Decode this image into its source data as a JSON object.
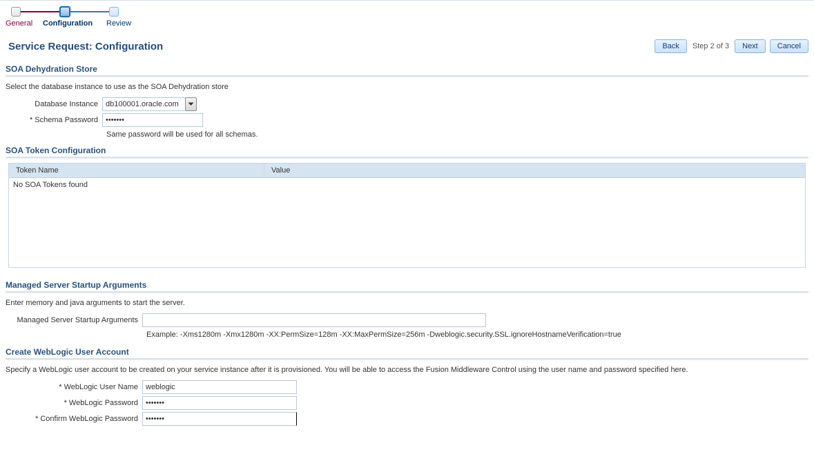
{
  "wizard": {
    "steps": [
      {
        "label": "General"
      },
      {
        "label": "Configuration"
      },
      {
        "label": "Review"
      }
    ],
    "step_indicator": "Step 2 of 3"
  },
  "page_title": "Service Request: Configuration",
  "buttons": {
    "back": "Back",
    "next": "Next",
    "cancel": "Cancel"
  },
  "soa_dehydration": {
    "title": "SOA Dehydration Store",
    "desc": "Select the database instance to use as the SOA Dehydration store",
    "db_label": "Database Instance",
    "db_value": "db100001.oracle.com",
    "schema_pwd_label": "Schema Password",
    "schema_pwd_value": "•••••••",
    "schema_pwd_hint": "Same password will be used for all schemas."
  },
  "soa_token": {
    "title": "SOA Token Configuration",
    "col_name": "Token Name",
    "col_value": "Value",
    "empty_text": "No SOA Tokens found"
  },
  "managed_server": {
    "title": "Managed Server Startup Arguments",
    "desc": "Enter memory and java arguments to start the server.",
    "label": "Managed Server Startup Arguments",
    "value": "",
    "example": "Example: -Xms1280m -Xmx1280m -XX:PermSize=128m -XX:MaxPermSize=256m -Dweblogic.security.SSL.ignoreHostnameVerification=true"
  },
  "weblogic": {
    "title": "Create WebLogic User Account",
    "desc": "Specify a WebLogic user account to be created on your service instance after it is provisioned. You will be able to access the Fusion Middleware Control using the user name and password specified here.",
    "user_label": "WebLogic User Name",
    "user_value": "weblogic",
    "pwd_label": "WebLogic Password",
    "pwd_value": "•••••••",
    "confirm_label": "Confirm WebLogic Password",
    "confirm_value": "•••••••"
  },
  "required_marker": "*"
}
